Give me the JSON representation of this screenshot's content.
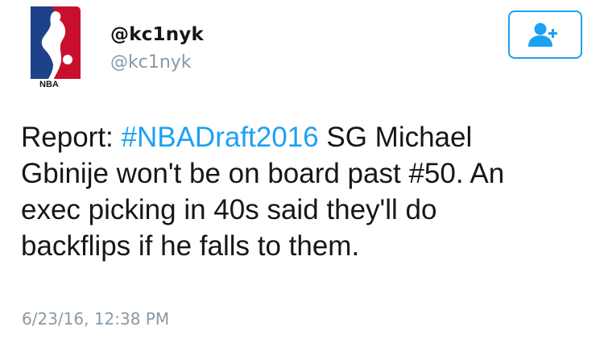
{
  "user": {
    "display_name": "@kc1nyk",
    "handle": "@kc1nyk",
    "avatar_icon": "nba-logo-icon",
    "avatar_logo_text": "NBA"
  },
  "follow_button": {
    "icon": "add-user-icon",
    "color": "#1da1f2"
  },
  "tweet": {
    "lines": [
      {
        "pre": "Report: ",
        "hashtag": "#NBADraft2016",
        "post": " SG Michael"
      },
      {
        "text": "Gbinije won't be on board past #50. An"
      },
      {
        "text": "exec picking in 40s said they'll do"
      },
      {
        "text": "backflips if he falls to them."
      }
    ],
    "timestamp": "6/23/16, 12:38 PM"
  },
  "colors": {
    "text": "#14171a",
    "muted": "#8899a6",
    "link": "#1da1f2",
    "nba_red": "#c8102e",
    "nba_blue": "#1d428a"
  }
}
